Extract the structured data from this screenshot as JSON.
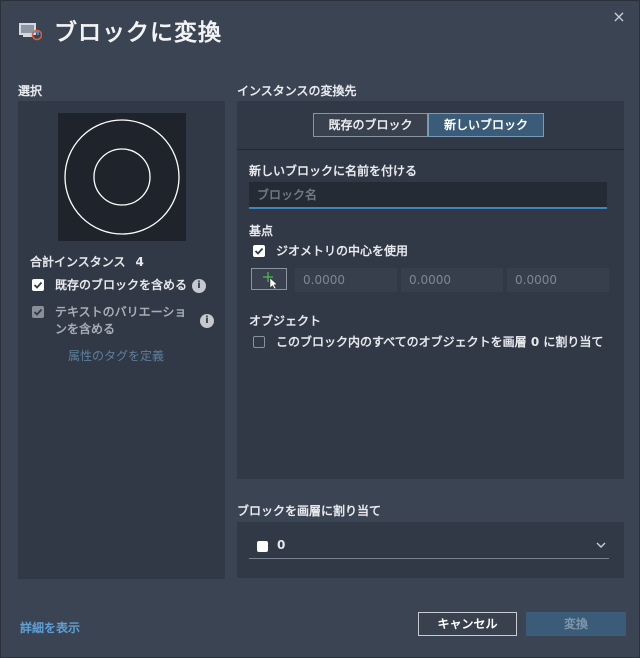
{
  "dialog": {
    "title": "ブロックに変換",
    "close_icon": "×"
  },
  "selection": {
    "heading": "選択",
    "total_label": "合計インスタンス",
    "total_count": "4",
    "include_existing_label": "既存のブロックを含める",
    "include_existing_checked": true,
    "include_text_label_line1": "テキストのバリエーショ",
    "include_text_label_line2": "ンを含める",
    "include_text_checked": true,
    "include_text_disabled": true,
    "define_attr_link": "属性のタグを定義"
  },
  "convert_to": {
    "heading": "インスタンスの変換先",
    "tabs": [
      {
        "label": "既存のブロック",
        "active": false
      },
      {
        "label": "新しいブロック",
        "active": true
      }
    ],
    "name_label": "新しいブロックに名前を付ける",
    "name_value": "",
    "name_placeholder": "ブロック名",
    "base_point_label": "基点",
    "use_center_label": "ジオメトリの中心を使用",
    "use_center_checked": true,
    "coords": [
      "0.0000",
      "0.0000",
      "0.0000"
    ],
    "objects_label": "オブジェクト",
    "assign_layer0_label": "このブロック内のすべてのオブジェクトを画層 0 に割り当て",
    "assign_layer0_checked": false
  },
  "layer": {
    "heading": "ブロックを画層に割り当て",
    "selected_value": "0",
    "swatch_color": "#ffffff"
  },
  "footer": {
    "show_details": "詳細を表示",
    "cancel": "キャンセル",
    "convert": "変換"
  },
  "colors": {
    "background": "#3b4453",
    "panel": "#313946",
    "accent": "#3b5c78",
    "link": "#5e9fd6",
    "input_underline": "#3c86bd"
  },
  "icons": [
    "app-block-icon",
    "close-icon",
    "info-icon",
    "pick-point-icon",
    "chevron-down-icon"
  ]
}
